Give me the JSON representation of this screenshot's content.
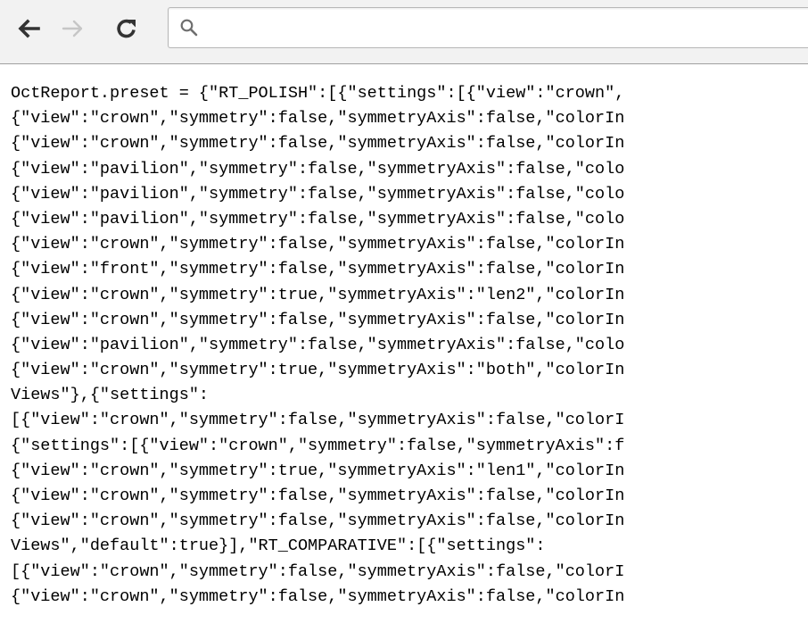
{
  "toolbar": {
    "back_icon": "arrow-left-icon",
    "forward_icon": "arrow-right-icon",
    "reload_icon": "reload-icon",
    "address_bar": {
      "icon": "search-icon",
      "value": "",
      "placeholder": ""
    }
  },
  "colors": {
    "toolbar_background": "#f2f2f2",
    "active_icon": "#333333",
    "disabled_icon": "#c6c6c6",
    "text": "#000000"
  },
  "content": {
    "lines": [
      "OctReport.preset = {\"RT_POLISH\":[{\"settings\":[{\"view\":\"crown\",",
      "{\"view\":\"crown\",\"symmetry\":false,\"symmetryAxis\":false,\"colorIn",
      "{\"view\":\"crown\",\"symmetry\":false,\"symmetryAxis\":false,\"colorIn",
      "{\"view\":\"pavilion\",\"symmetry\":false,\"symmetryAxis\":false,\"colo",
      "{\"view\":\"pavilion\",\"symmetry\":false,\"symmetryAxis\":false,\"colo",
      "{\"view\":\"pavilion\",\"symmetry\":false,\"symmetryAxis\":false,\"colo",
      "{\"view\":\"crown\",\"symmetry\":false,\"symmetryAxis\":false,\"colorIn",
      "{\"view\":\"front\",\"symmetry\":false,\"symmetryAxis\":false,\"colorIn",
      "{\"view\":\"crown\",\"symmetry\":true,\"symmetryAxis\":\"len2\",\"colorIn",
      "{\"view\":\"crown\",\"symmetry\":false,\"symmetryAxis\":false,\"colorIn",
      "{\"view\":\"pavilion\",\"symmetry\":false,\"symmetryAxis\":false,\"colo",
      "{\"view\":\"crown\",\"symmetry\":true,\"symmetryAxis\":\"both\",\"colorIn",
      "Views\"},{\"settings\":",
      "[{\"view\":\"crown\",\"symmetry\":false,\"symmetryAxis\":false,\"colorI",
      "{\"settings\":[{\"view\":\"crown\",\"symmetry\":false,\"symmetryAxis\":f",
      "{\"view\":\"crown\",\"symmetry\":true,\"symmetryAxis\":\"len1\",\"colorIn",
      "{\"view\":\"crown\",\"symmetry\":false,\"symmetryAxis\":false,\"colorIn",
      "{\"view\":\"crown\",\"symmetry\":false,\"symmetryAxis\":false,\"colorIn",
      "Views\",\"default\":true}],\"RT_COMPARATIVE\":[{\"settings\":",
      "[{\"view\":\"crown\",\"symmetry\":false,\"symmetryAxis\":false,\"colorI",
      "{\"view\":\"crown\",\"symmetry\":false,\"symmetryAxis\":false,\"colorIn"
    ]
  }
}
